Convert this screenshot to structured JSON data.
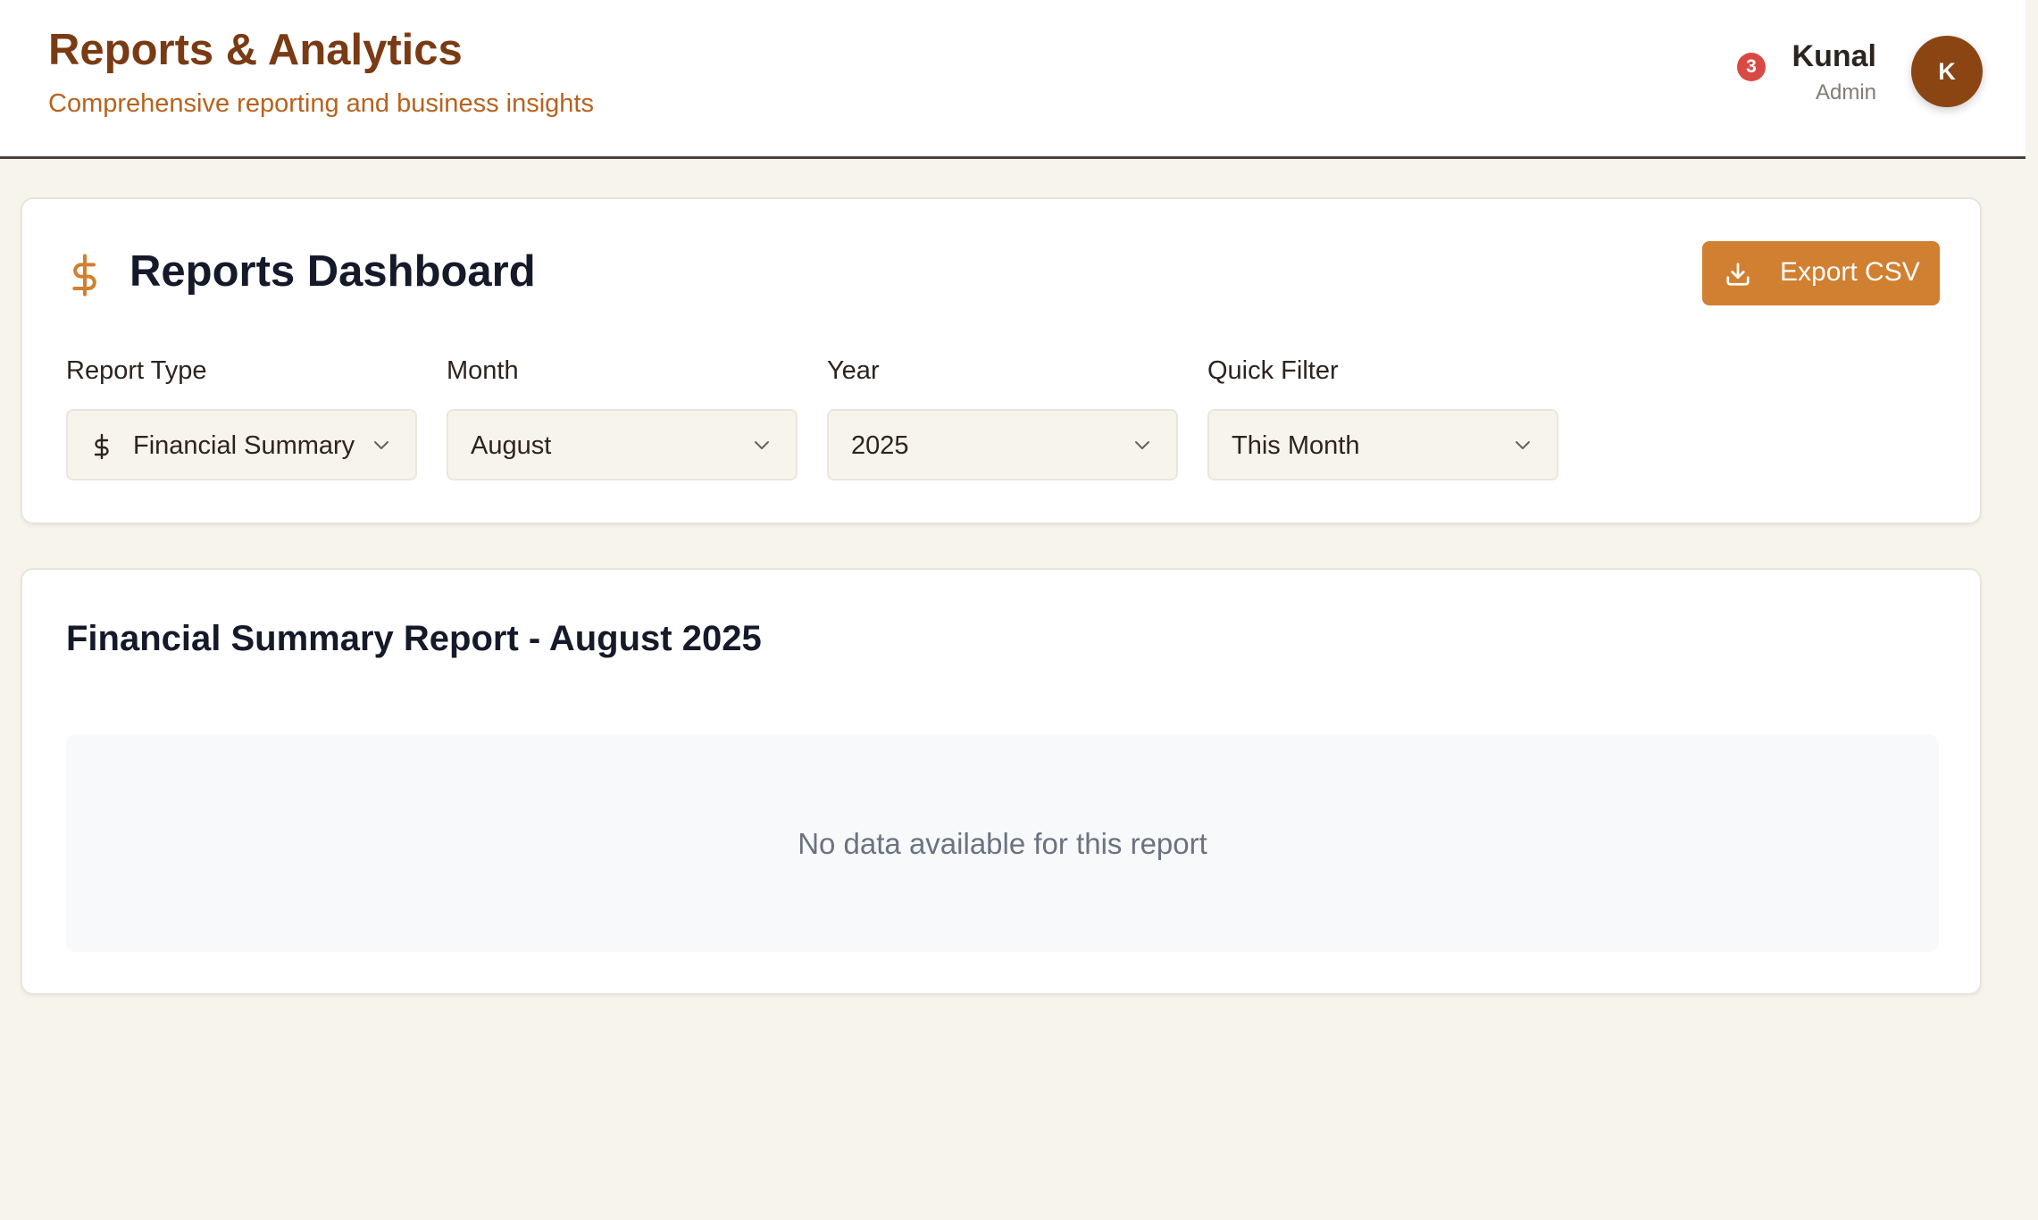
{
  "header": {
    "title": "Reports & Analytics",
    "subtitle": "Comprehensive reporting and business insights",
    "notification_count": "3",
    "user_name": "Kunal",
    "user_role": "Admin",
    "avatar_initial": "K"
  },
  "dashboard": {
    "title": "Reports Dashboard",
    "title_icon": "dollar-icon",
    "export_label": "Export CSV",
    "export_icon": "download-icon",
    "filters": [
      {
        "label": "Report Type",
        "value": "Financial Summary",
        "icon": "dollar-icon"
      },
      {
        "label": "Month",
        "value": "August"
      },
      {
        "label": "Year",
        "value": "2025"
      },
      {
        "label": "Quick Filter",
        "value": "This Month"
      }
    ]
  },
  "report": {
    "title": "Financial Summary Report - August 2025",
    "empty_message": "No data available for this report"
  },
  "colors": {
    "accent": "#d17f30",
    "brand_dark": "#7a3b14",
    "badge": "#d94a45",
    "background": "#f7f4ec"
  }
}
